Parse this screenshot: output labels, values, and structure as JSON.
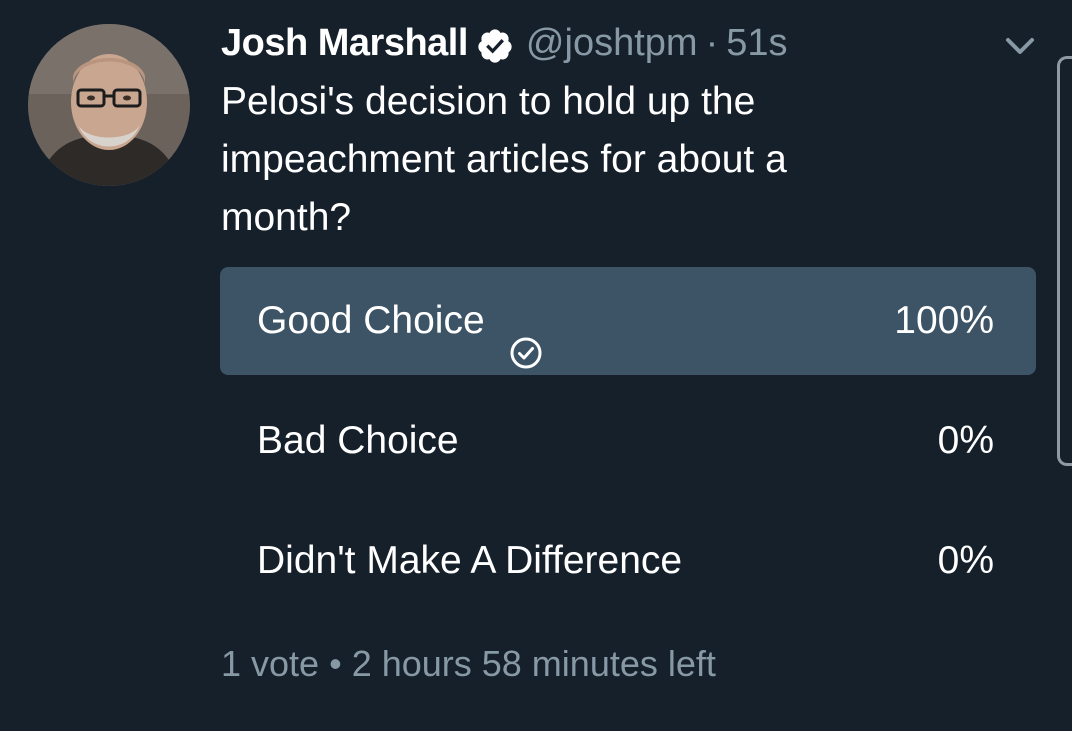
{
  "tweet": {
    "author_name": "Josh Marshall",
    "handle": "@joshtpm",
    "separator": "·",
    "time": "51s",
    "text": "Pelosi's decision to hold up the impeachment articles for about a month?"
  },
  "poll": {
    "options": [
      {
        "label": "Good Choice",
        "percent": "100%",
        "value": 100,
        "selected": true
      },
      {
        "label": "Bad Choice",
        "percent": "0%",
        "value": 0,
        "selected": false
      },
      {
        "label": "Didn't Make A Difference",
        "percent": "0%",
        "value": 0,
        "selected": false
      }
    ],
    "votes": "1 vote",
    "footer_separator": "•",
    "time_left": "2 hours 58 minutes left"
  },
  "colors": {
    "background": "#16202b",
    "poll_fill": "#3d5466",
    "secondary_text": "#8899a6",
    "primary_text": "#ffffff"
  },
  "icons": {
    "verified": "verified-badge-icon",
    "caret": "chevron-down-icon",
    "selected": "check-circle-icon"
  }
}
